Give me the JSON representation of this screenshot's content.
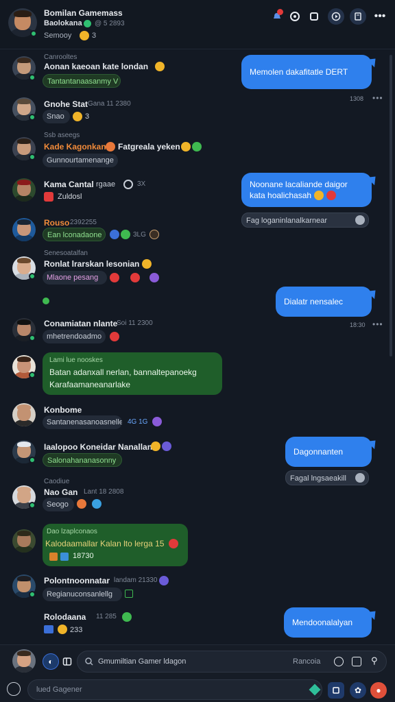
{
  "header": {
    "title": "Bomilan Gamemass",
    "subtitle": "Baolokana",
    "subtitle_meta": "@ 5 2893",
    "status": "Semooy",
    "status_count": "3"
  },
  "messages": [
    {
      "meta": "Canrooltes",
      "text": "Aonan kaeoan kate londan"
    },
    {
      "pill": "Tantantanaasanmy V"
    },
    {
      "name": "Gnohe Stat",
      "meta": "Gana 11 2380"
    },
    {
      "pill": "Snao",
      "count": "3"
    },
    {
      "meta": "Ssb aseegs",
      "name": "Kade Kagonkan",
      "text": "Fatgreala yeken"
    },
    {
      "pill": "Gunnourtamenange"
    },
    {
      "name": "Kama Cantal",
      "meta": "rgaae",
      "extra": "3X"
    },
    {
      "pill": "Zuldosl"
    },
    {
      "name": "Rouso",
      "meta": "2392255"
    },
    {
      "pill": "Ean lconadaone",
      "extra": "3LG"
    },
    {
      "meta": "Senesoatalfan",
      "name": "Ronlat lrarskan lesonian"
    },
    {
      "pill": "Mlaone pesang"
    },
    {
      "name": "Conamiatan nlante",
      "meta": "Soi 11 2300"
    },
    {
      "pill": "mhetrendoadmo"
    },
    {
      "meta": "Lami lue nooskes",
      "text": "Batan adanxall nerlan, bannaltepanoekg",
      "text2": "Karafaamaneanarlake"
    },
    {
      "name": "Konbome"
    },
    {
      "pill": "Santanenasanoasnelle",
      "extra": "4G 1G"
    },
    {
      "name": "Iaalopoo Koneidar Nanalland"
    },
    {
      "pill": "Salonahananasonny"
    },
    {
      "meta": "Caodiue",
      "name": "Nao Gan",
      "meta2": "Lant 18 2808"
    },
    {
      "pill": "Seogo"
    },
    {
      "meta": "Dao lzaplconaos",
      "text": "Kalodaamallar Kalan lto lerga 15",
      "count": "18730"
    },
    {
      "name": "Polontnoonnatar",
      "meta": "landam 21330"
    },
    {
      "pill": "Regianuconsanlellg"
    },
    {
      "name": "Rolodaana",
      "meta": "11 285"
    },
    {
      "count": "233"
    }
  ],
  "outgoing": [
    {
      "text": "Memolen dakafitatle DERT",
      "time": "1308"
    },
    {
      "text": "Noonane lacaliande daigor",
      "text2": "kata hoalichasah",
      "reply": "Fag loganinlanalkarnear"
    },
    {
      "text": "Dialatr nensalec",
      "time": "18:30"
    },
    {
      "text": "Dagonnanten",
      "reply": "Fagal lngsaeakill"
    },
    {
      "text": "Mendoonalalyan"
    }
  ],
  "composer": {
    "placeholder": "Gmumiltian Gamer ldagon",
    "right_label": "Rancoia",
    "secondary_placeholder": "lued Gagener"
  },
  "colors": {
    "background": "#131923",
    "outgoing_bubble": "#2f80ed",
    "incoming_highlight": "#1f5e2a",
    "online": "#2fbf71",
    "alert": "#e23a3a"
  }
}
